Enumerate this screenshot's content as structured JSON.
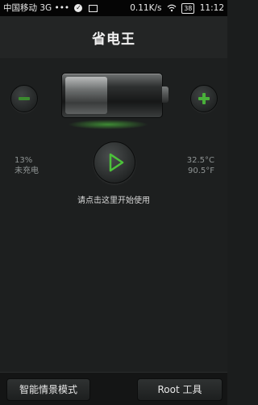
{
  "status_bar": {
    "carrier": "中国移动 3G",
    "dots": "•••",
    "net_speed": "0.11K/s",
    "battery": "38",
    "time": "11:12"
  },
  "header": {
    "title": "省电王"
  },
  "battery": {
    "level_fraction": 0.45
  },
  "info": {
    "percent": "13%",
    "charge_state": "未充电",
    "temp_c": "32.5°C",
    "temp_f": "90.5°F"
  },
  "hint": "请点击这里开始使用",
  "bottom": {
    "left_button": "智能情景模式",
    "right_button": "Root 工具"
  },
  "colors": {
    "accent_green": "#49b03a"
  }
}
